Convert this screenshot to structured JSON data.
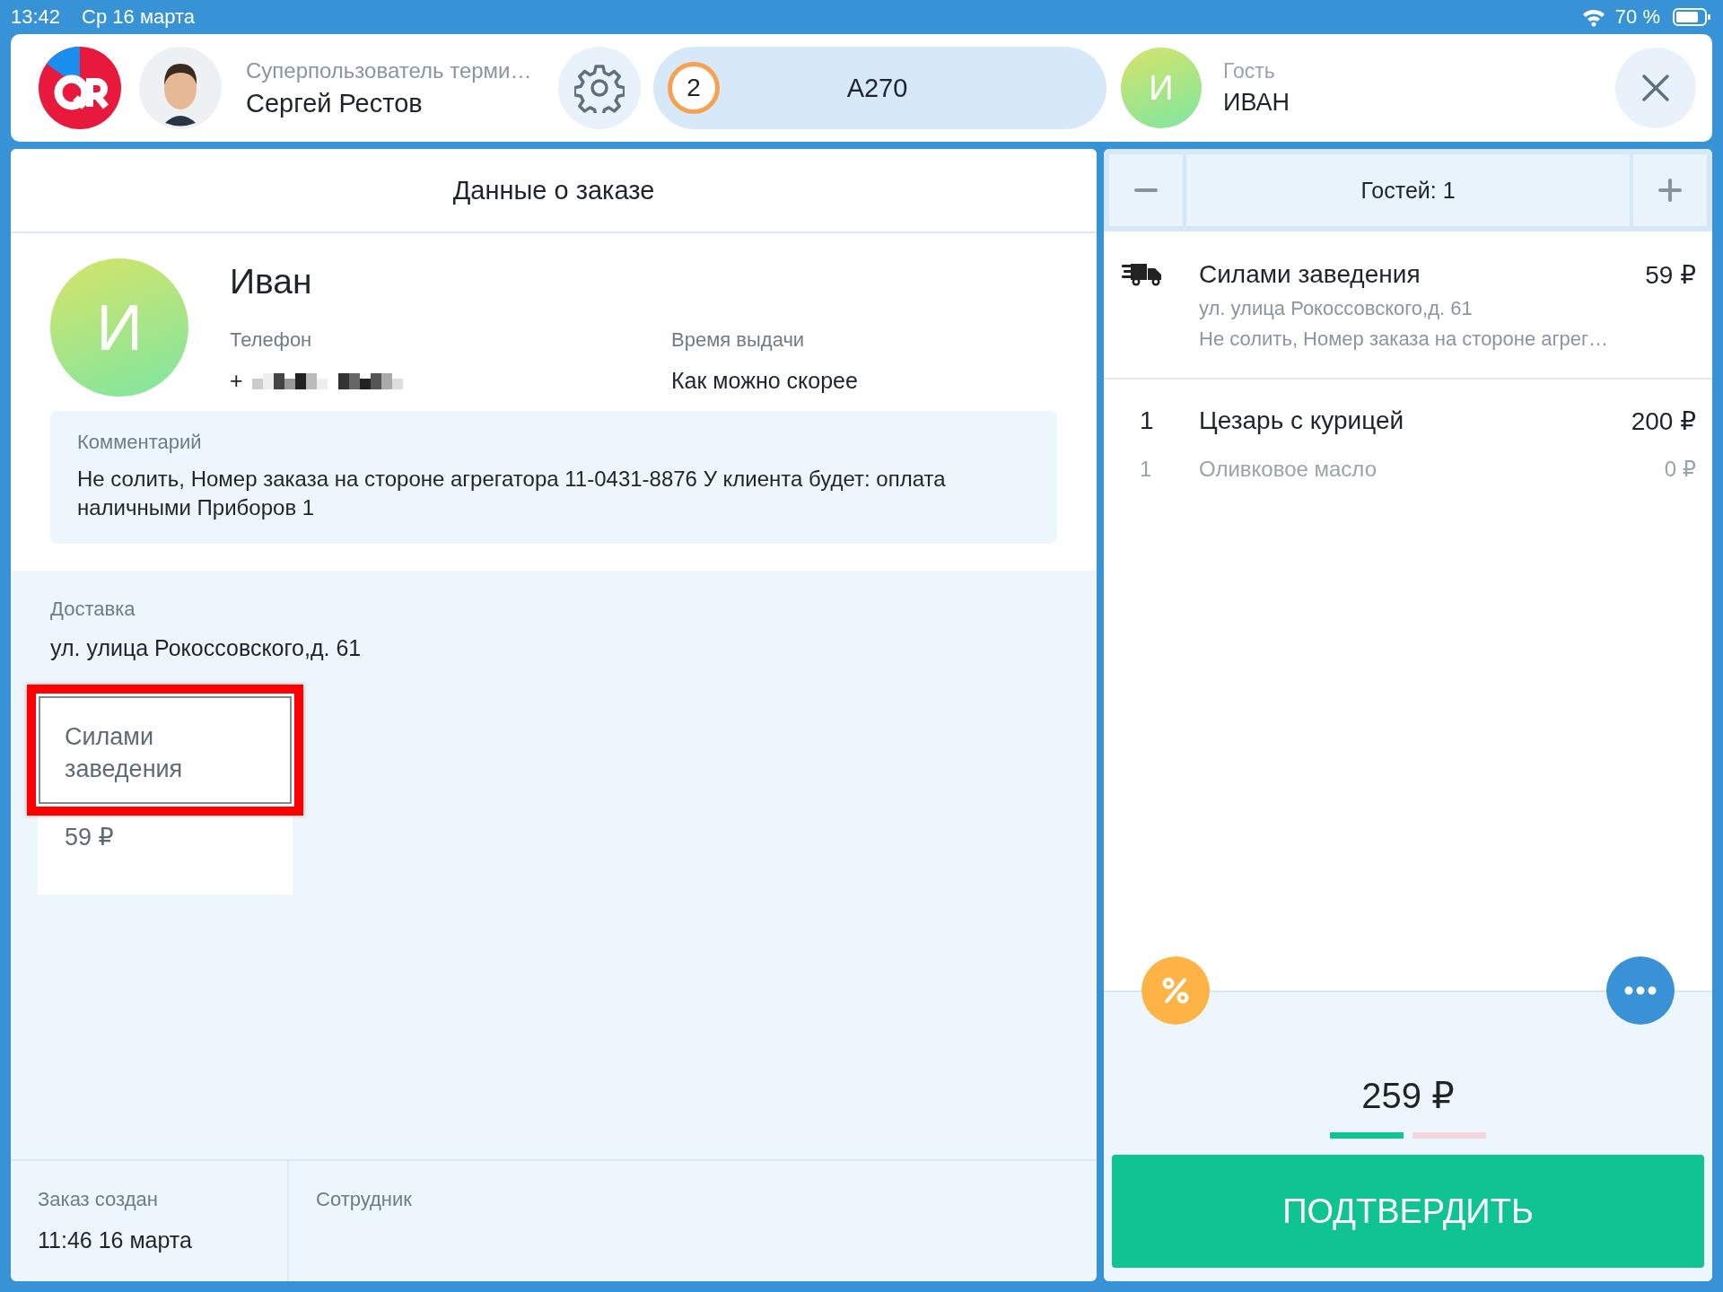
{
  "status_bar": {
    "time": "13:42",
    "date": "Ср 16 марта",
    "battery": "70 %"
  },
  "header": {
    "user_role": "Суперпользователь терми…",
    "user_name": "Сергей Рестов",
    "order_count": "2",
    "order_number": "A270",
    "guest_initial": "И",
    "guest_label": "Гость",
    "guest_name": "ИВАН"
  },
  "order": {
    "title": "Данные о заказе",
    "customer": {
      "initial": "И",
      "name": "Иван"
    },
    "fields": [
      {
        "label": "Телефон",
        "value": "+",
        "redacted": true
      },
      {
        "label": "Время выдачи",
        "value": "Как можно скорее",
        "redacted": false
      }
    ],
    "comment": {
      "label": "Комментарий",
      "text": "Не солить, Номер заказа на стороне агрегатора 11-0431-8876 У клиента будет: оплата наличными Приборов 1"
    },
    "delivery": {
      "label": "Доставка",
      "address": "ул. улица Рокоссовского,д. 61",
      "options": [
        {
          "name": "Силами заведения",
          "price": "59 ₽",
          "highlighted": true
        }
      ]
    },
    "footer": [
      {
        "label": "Заказ создан",
        "value": "11:46 16 марта"
      },
      {
        "label": "Сотрудник"
      }
    ]
  },
  "cart": {
    "guests": "Гостей: 1",
    "delivery": {
      "name": "Силами заведения",
      "price": "59 ₽",
      "address": "ул. улица Рокоссовского,д. 61",
      "note": "Не солить, Номер заказа на стороне агрег…"
    },
    "items": [
      {
        "kind": "dish",
        "qty": "1",
        "name": "Цезарь с курицей",
        "price": "200 ₽"
      },
      {
        "kind": "modifier",
        "qty": "1",
        "name": "Оливковое масло",
        "price": "0 ₽"
      }
    ],
    "total": "259 ₽",
    "payment_bars": [
      {
        "color": "#10c495"
      },
      {
        "color": "#f5d6dd"
      }
    ],
    "confirm": "ПОДТВЕРДИТЬ"
  }
}
